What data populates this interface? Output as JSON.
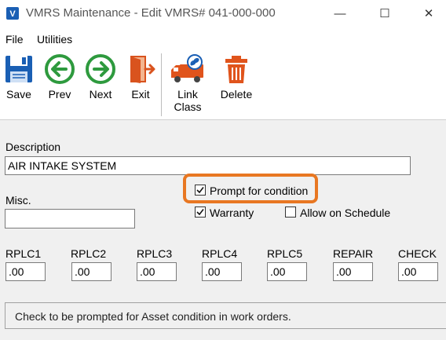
{
  "window": {
    "title": "VMRS Maintenance - Edit VMRS# 041-000-000",
    "minimize_glyph": "—",
    "maximize_glyph": "☐",
    "close_glyph": "✕"
  },
  "menu": [
    "File",
    "Utilities"
  ],
  "toolbar": {
    "save": "Save",
    "prev": "Prev",
    "next": "Next",
    "exit": "Exit",
    "link_class_line1": "Link",
    "link_class_line2": "Class",
    "delete": "Delete"
  },
  "form": {
    "description_label": "Description",
    "description_value": "AIR INTAKE SYSTEM",
    "misc_label": "Misc.",
    "misc_value": "",
    "prompt_condition_label": "Prompt for condition",
    "prompt_condition_checked": true,
    "warranty_label": "Warranty",
    "warranty_checked": true,
    "allow_schedule_label": "Allow on Schedule",
    "allow_schedule_checked": false,
    "fields": [
      {
        "label": "RPLC1",
        "value": ".00"
      },
      {
        "label": "RPLC2",
        "value": ".00"
      },
      {
        "label": "RPLC3",
        "value": ".00"
      },
      {
        "label": "RPLC4",
        "value": ".00"
      },
      {
        "label": "RPLC5",
        "value": ".00"
      },
      {
        "label": "REPAIR",
        "value": ".00"
      },
      {
        "label": "CHECK",
        "value": ".00"
      }
    ]
  },
  "status_text": "Check to be prompted for Asset condition in work orders.",
  "colors": {
    "accent_blue": "#1a5fb4",
    "arrow_green": "#2e9a3e",
    "exit_orange": "#d9531e",
    "delete_orange": "#e0541c",
    "highlight_orange": "#e87722"
  }
}
